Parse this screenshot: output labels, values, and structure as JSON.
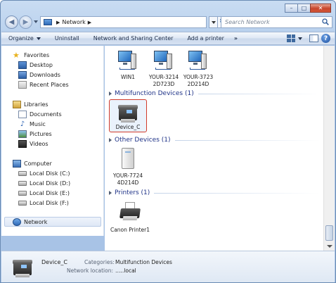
{
  "window": {
    "caption_buttons": {
      "minimize": "–",
      "maximize": "□",
      "close": "✕"
    }
  },
  "address_bar": {
    "location": "Network",
    "search_placeholder": "Search Network"
  },
  "toolbar": {
    "organize": "Organize",
    "uninstall": "Uninstall",
    "network_center": "Network and Sharing Center",
    "add_printer": "Add a printer",
    "more": "»"
  },
  "nav": {
    "favorites": "Favorites",
    "desktop": "Desktop",
    "downloads": "Downloads",
    "recent": "Recent Places",
    "libraries": "Libraries",
    "documents": "Documents",
    "music": "Music",
    "pictures": "Pictures",
    "videos": "Videos",
    "computer": "Computer",
    "disk_c": "Local Disk (C:)",
    "disk_d": "Local Disk (D:)",
    "disk_e": "Local Disk (E:)",
    "disk_f": "Local Disk (F:)",
    "network": "Network"
  },
  "content": {
    "computers": [
      {
        "l1": "WIN1",
        "l2": ""
      },
      {
        "l1": "YOUR-3214",
        "l2": "2D723D"
      },
      {
        "l1": "YOUR-3723",
        "l2": "2D214D"
      }
    ],
    "group_mf": "Multifunction Devices (1)",
    "mf_device": "Device_C",
    "group_other": "Other Devices (1)",
    "other_device": {
      "l1": "YOUR-7724",
      "l2": "4D214D"
    },
    "group_printers": "Printers (1)",
    "printer": "Canon Printer1"
  },
  "details": {
    "name": "Device_C",
    "categories_label": "Categories:",
    "categories": "Multifunction Devices",
    "location_label": "Network location:",
    "location": "…..local"
  },
  "icons": {
    "back": "back-arrow-icon",
    "forward": "forward-arrow-icon",
    "refresh": "refresh-icon",
    "search": "search-icon",
    "help": "help-icon"
  }
}
